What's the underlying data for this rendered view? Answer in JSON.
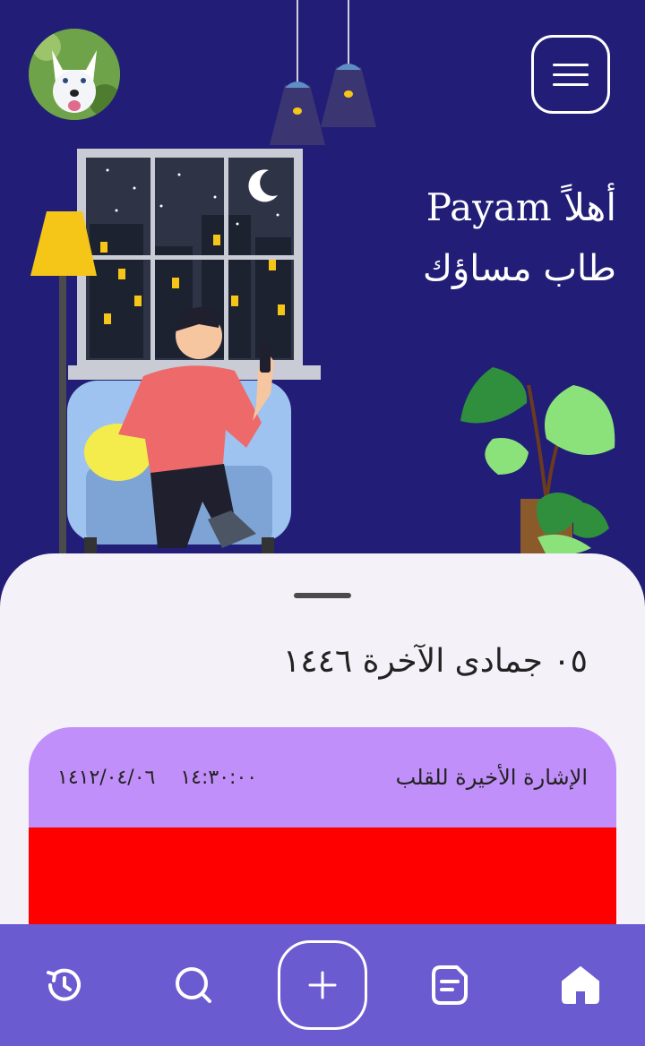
{
  "header": {
    "greeting_line1": "أهلاً Payam",
    "greeting_line2": "طاب مساؤك"
  },
  "sheet": {
    "date": "٠٥ جمادى الآخرة ١٤٤٦"
  },
  "card": {
    "label": "الإشارة الأخيرة للقلب",
    "time": "١٤:٣٠:٠٠",
    "date": "١٤١٢/٠٤/٠٦",
    "header_color": "#c18ff9",
    "body_color": "#ff0000"
  },
  "navbar": {
    "items": [
      "home-icon",
      "document-icon",
      "add-icon",
      "search-icon",
      "history-icon"
    ],
    "color": "#6b5bd0"
  },
  "colors": {
    "hero_bg": "#221e77",
    "sheet_bg": "#f4f1f9"
  }
}
